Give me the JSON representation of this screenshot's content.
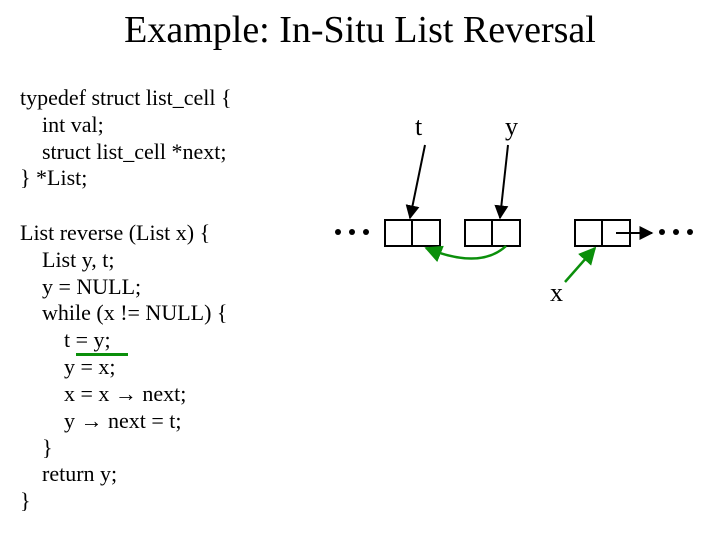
{
  "title": "Example: In-Situ List Reversal",
  "typedef_code": "typedef struct list_cell {\n    int val;\n    struct list_cell *next;\n} *List;",
  "reverse_code": "List reverse (List x) {\n    List y, t;\n    y = NULL;\n    while (x != NULL) {\n        t = y;\n        y = x;\n        x = x → next;\n        y → next = t;\n    }\n    return y;\n}",
  "labels": {
    "t": "t",
    "y": "y",
    "x": "x"
  },
  "chart_data": {
    "type": "diagram",
    "title": "In-situ list reversal pointer diagram",
    "nodes": [
      {
        "id": "ellipsis-left",
        "kind": "ellipsis"
      },
      {
        "id": "cell1",
        "kind": "list-cell",
        "fields": [
          "val",
          "next"
        ]
      },
      {
        "id": "cell2",
        "kind": "list-cell",
        "fields": [
          "val",
          "next"
        ]
      },
      {
        "id": "cell3",
        "kind": "list-cell",
        "fields": [
          "val",
          "next"
        ]
      },
      {
        "id": "ellipsis-right",
        "kind": "ellipsis"
      }
    ],
    "pointers": [
      {
        "name": "t",
        "target": "cell1"
      },
      {
        "name": "y",
        "target": "cell2"
      },
      {
        "name": "x",
        "target": "cell3"
      }
    ],
    "links": [
      {
        "from": "cell1.next",
        "to": "ellipsis-left"
      },
      {
        "from": "cell2.next",
        "to": "cell1"
      },
      {
        "from": "cell3.next",
        "to": "ellipsis-right"
      }
    ]
  }
}
